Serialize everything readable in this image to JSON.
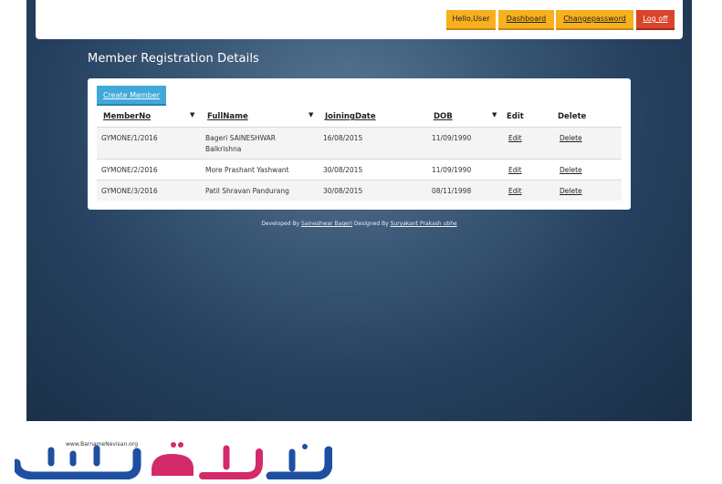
{
  "nav": {
    "greeting": "Hello,User",
    "dashboard": "Dashboard",
    "change_password": "Changepassword",
    "logoff": "Log off"
  },
  "page": {
    "title": "Member Registration Details",
    "create_button": "Create Member"
  },
  "table": {
    "headers": [
      "MemberNo",
      "FullName",
      "JoiningDate",
      "DOB",
      "Edit",
      "Delete"
    ],
    "rows": [
      {
        "member_no": "GYMONE/1/2016",
        "full_name_1": "Bageri SAINESHWAR",
        "full_name_2": "Balkrishna",
        "joining": "16/08/2015",
        "dob": "11/09/1990",
        "edit": "Edit",
        "delete": "Delete"
      },
      {
        "member_no": "GYMONE/2/2016",
        "full_name_1": "More Prashant Yashwant",
        "full_name_2": "",
        "joining": "30/08/2015",
        "dob": "11/09/1990",
        "edit": "Edit",
        "delete": "Delete"
      },
      {
        "member_no": "GYMONE/3/2016",
        "full_name_1": "Patil Shravan Pandurang",
        "full_name_2": "",
        "joining": "30/08/2015",
        "dob": "08/11/1998",
        "edit": "Edit",
        "delete": "Delete"
      }
    ]
  },
  "footer": {
    "developed_by": "Developed By",
    "developer": "Saineshwar Bageri",
    "designed_by": "Designed By",
    "designer": "Suryakant Prakash ubhe"
  },
  "watermark": {
    "url": "www.BarnameNevisan.org"
  },
  "colors": {
    "nav_button": "#f7b01e",
    "logoff_button": "#d9442a",
    "create_button": "#3fa9d9",
    "logo_blue": "#1e4fa0",
    "logo_pink": "#d42a6a"
  }
}
